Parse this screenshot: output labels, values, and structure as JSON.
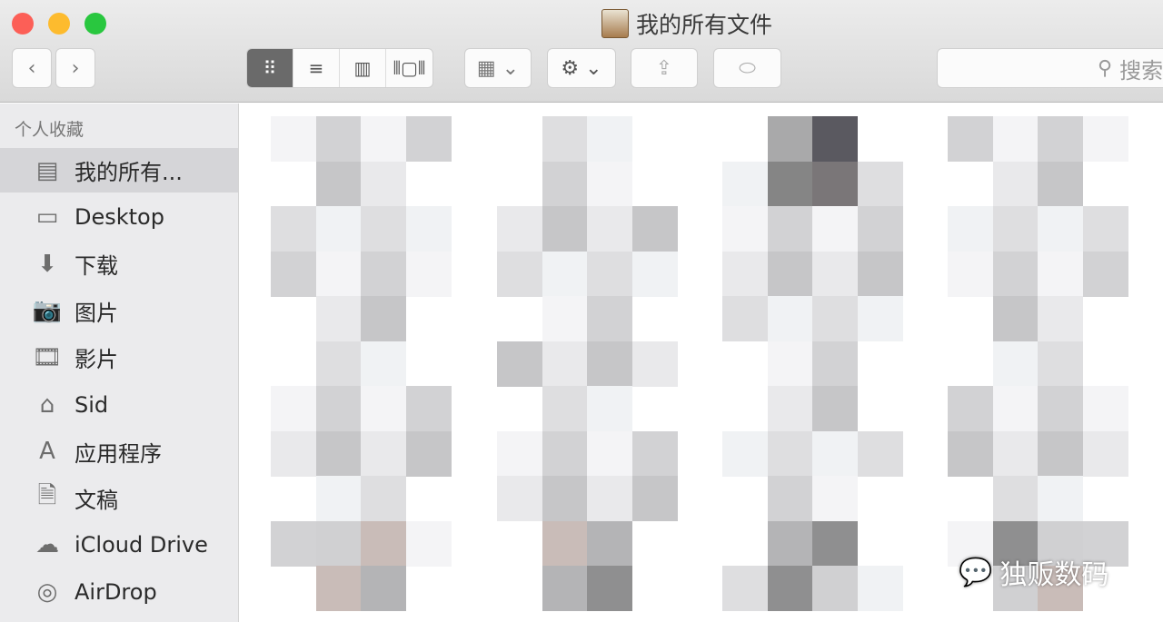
{
  "window": {
    "title": "我的所有文件",
    "title_icon": "all-my-files-drawer-icon"
  },
  "toolbar": {
    "back": "‹",
    "forward": "›",
    "view_modes": [
      {
        "name": "icon",
        "glyph": "⠿",
        "active": true
      },
      {
        "name": "list",
        "glyph": "≡",
        "active": false
      },
      {
        "name": "columns",
        "glyph": "▥",
        "active": false
      },
      {
        "name": "coverflow",
        "glyph": "⫴▢⫴",
        "active": false
      }
    ],
    "arrange": "▦ ⌄",
    "action": "⚙ ⌄",
    "share": "⇪",
    "tag": "⬭",
    "search_placeholder": "搜索"
  },
  "sidebar": {
    "header": "个人收藏",
    "items": [
      {
        "label": "我的所有...",
        "icon": "all-files-icon",
        "glyph": "▤",
        "selected": true
      },
      {
        "label": "Desktop",
        "icon": "desktop-icon",
        "glyph": "▭"
      },
      {
        "label": "下载",
        "icon": "downloads-icon",
        "glyph": "⬇"
      },
      {
        "label": "图片",
        "icon": "camera-icon",
        "glyph": "📷"
      },
      {
        "label": "影片",
        "icon": "film-icon",
        "glyph": "🎞"
      },
      {
        "label": "Sid",
        "icon": "home-icon",
        "glyph": "⌂"
      },
      {
        "label": "应用程序",
        "icon": "applications-icon",
        "glyph": "A"
      },
      {
        "label": "文稿",
        "icon": "documents-icon",
        "glyph": "🗎"
      },
      {
        "label": "iCloud Drive",
        "icon": "cloud-icon",
        "glyph": "☁"
      },
      {
        "label": "AirDrop",
        "icon": "airdrop-icon",
        "glyph": "◎"
      }
    ]
  },
  "watermark": {
    "text": "独贩数码",
    "icon": "wechat-icon"
  }
}
